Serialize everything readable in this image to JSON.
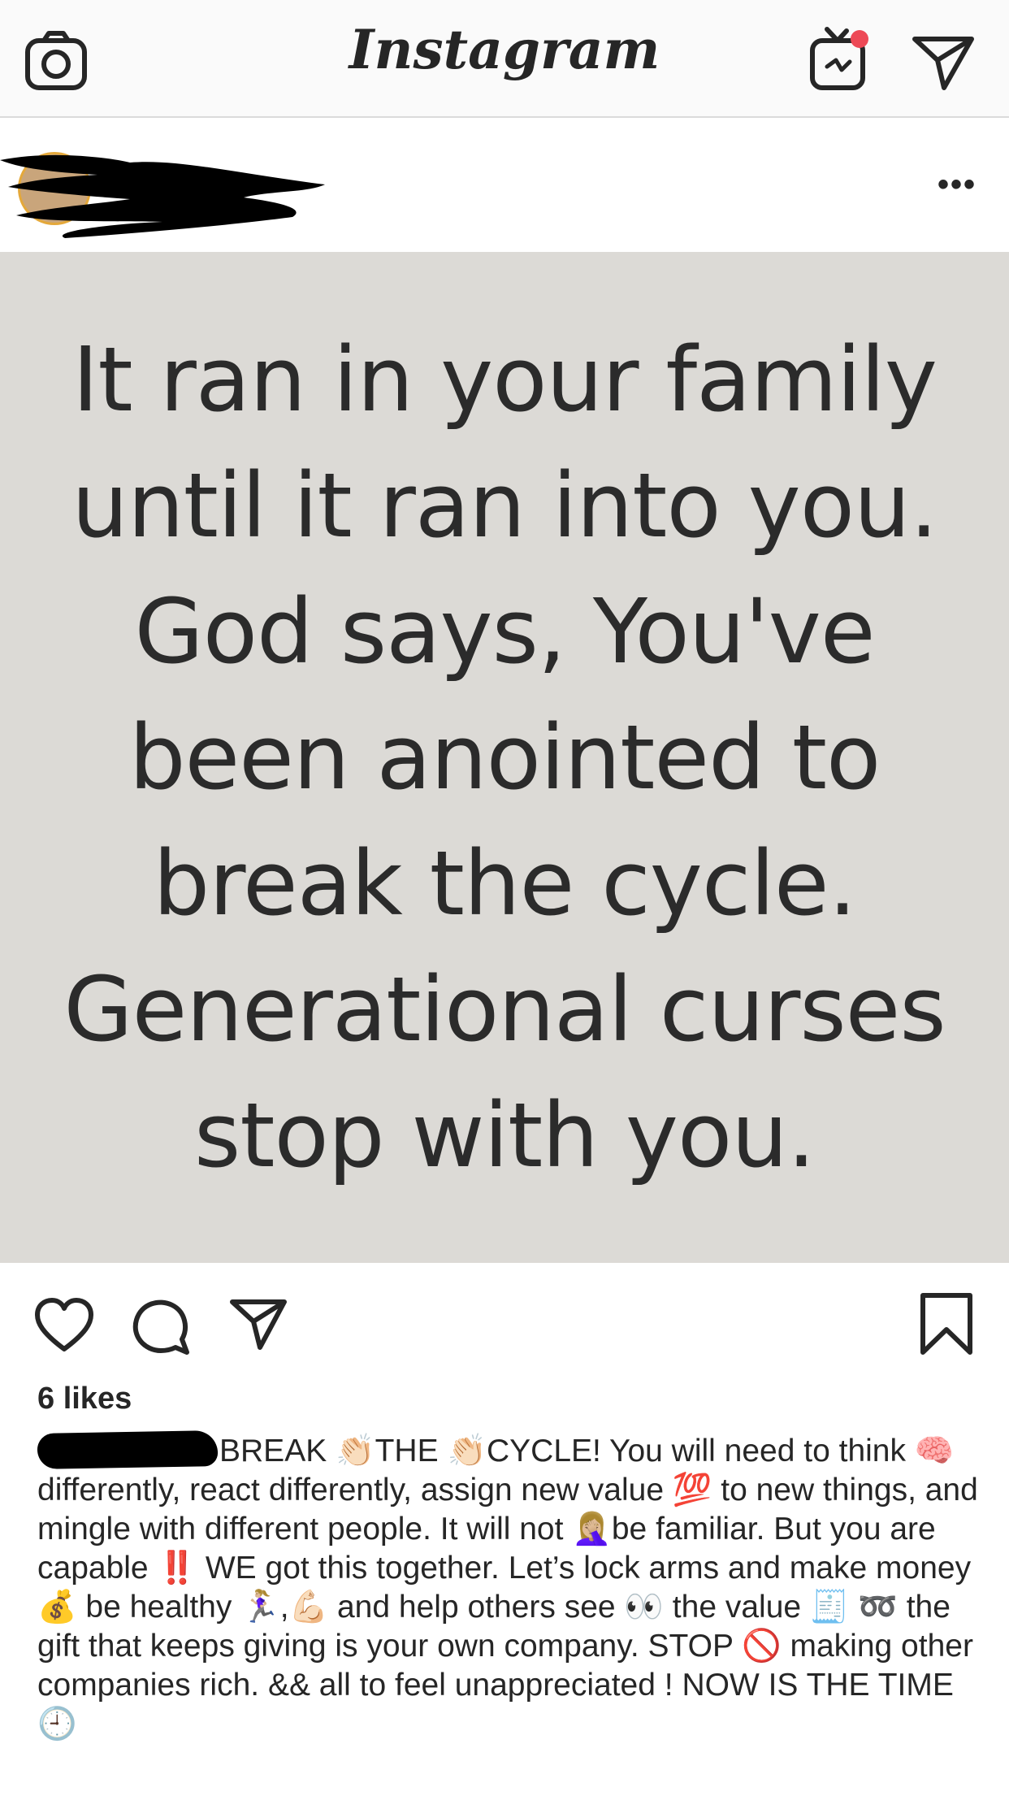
{
  "app": {
    "wordmark": "Instagram"
  },
  "post": {
    "quote_lines": "It ran in your family\nuntil it ran into you.\nGod says, You've\nbeen anointed to\nbreak the cycle.\nGenerational curses\nstop with you.",
    "likes": "6 likes",
    "caption": "BREAK 👏🏻THE 👏🏻CYCLE! You will need to think 🧠 differently, react differently, assign new value 💯 to new things, and mingle with different people. It will not 🤦🏼‍♀️be familiar. But you are capable ‼️ WE got this together. Let’s lock arms and make money 💰 be healthy 🏃🏼‍♀️,💪🏻 and help others see 👀 the value 🧾 ➿ the gift that keeps giving is your own company. STOP 🚫 making other companies rich. && all to feel unappreciated ! NOW IS THE TIME 🕘",
    "more_label": "•••"
  },
  "colors": {
    "topbar_bg": "#fafafa",
    "image_bg": "#dcdad6",
    "notification_dot": "#ed4956",
    "text": "#262626"
  },
  "icons": [
    "camera-icon",
    "igtv-icon",
    "direct-message-icon",
    "more-options-icon",
    "heart-icon",
    "comment-icon",
    "share-icon",
    "bookmark-icon"
  ]
}
